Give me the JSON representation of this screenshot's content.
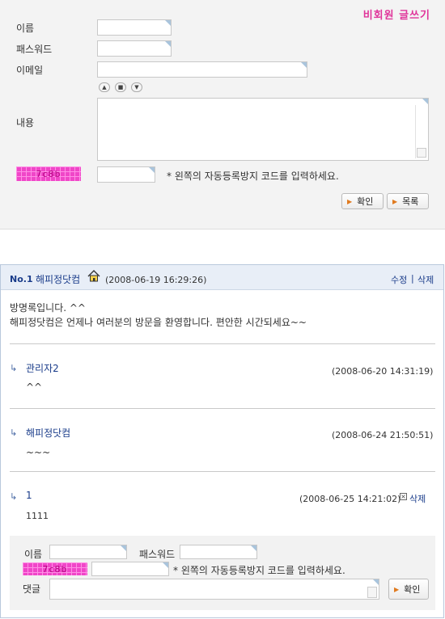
{
  "write_form": {
    "title": "비회원 글쓰기",
    "name_label": "이름",
    "password_label": "패스워드",
    "email_label": "이메일",
    "content_label": "내용",
    "captcha_code": "7c8b",
    "captcha_note": "* 왼쪽의 자동등록방지 코드를 입력하세요.",
    "confirm_label": "확인",
    "list_label": "목록",
    "resize_buttons": [
      "▲",
      "■",
      "▼"
    ]
  },
  "post": {
    "number": "No.1",
    "author": "해피정닷컴",
    "datetime": "(2008-06-19 16:29:26)",
    "edit_label": "수정",
    "divider": "|",
    "delete_label": "삭제",
    "body_line1": "방명록입니다. ^^",
    "body_line2": "해피정닷컴은 언제나 여러분의 방문을 환영합니다. 편안한 시간되세요~~"
  },
  "replies": [
    {
      "author": "관리자2",
      "datetime": "(2008-06-20 14:31:19)",
      "text": "^^"
    },
    {
      "author": "해피정닷컴",
      "datetime": "(2008-06-24 21:50:51)",
      "text": "~~~"
    },
    {
      "author": "1",
      "datetime": "(2008-06-25 14:21:02)",
      "delete_label": "삭제",
      "text": "1111"
    }
  ],
  "comment_form": {
    "name_label": "이름",
    "password_label": "패스워드",
    "captcha_code": "7c8b",
    "captcha_note": "* 왼쪽의 자동등록방지 코드를 입력하세요.",
    "comment_label": "댓글",
    "confirm_label": "확인"
  },
  "colors": {
    "accent_pink": "#e0349a",
    "link_blue": "#1a3c8a",
    "header_bg": "#e8eef7"
  }
}
